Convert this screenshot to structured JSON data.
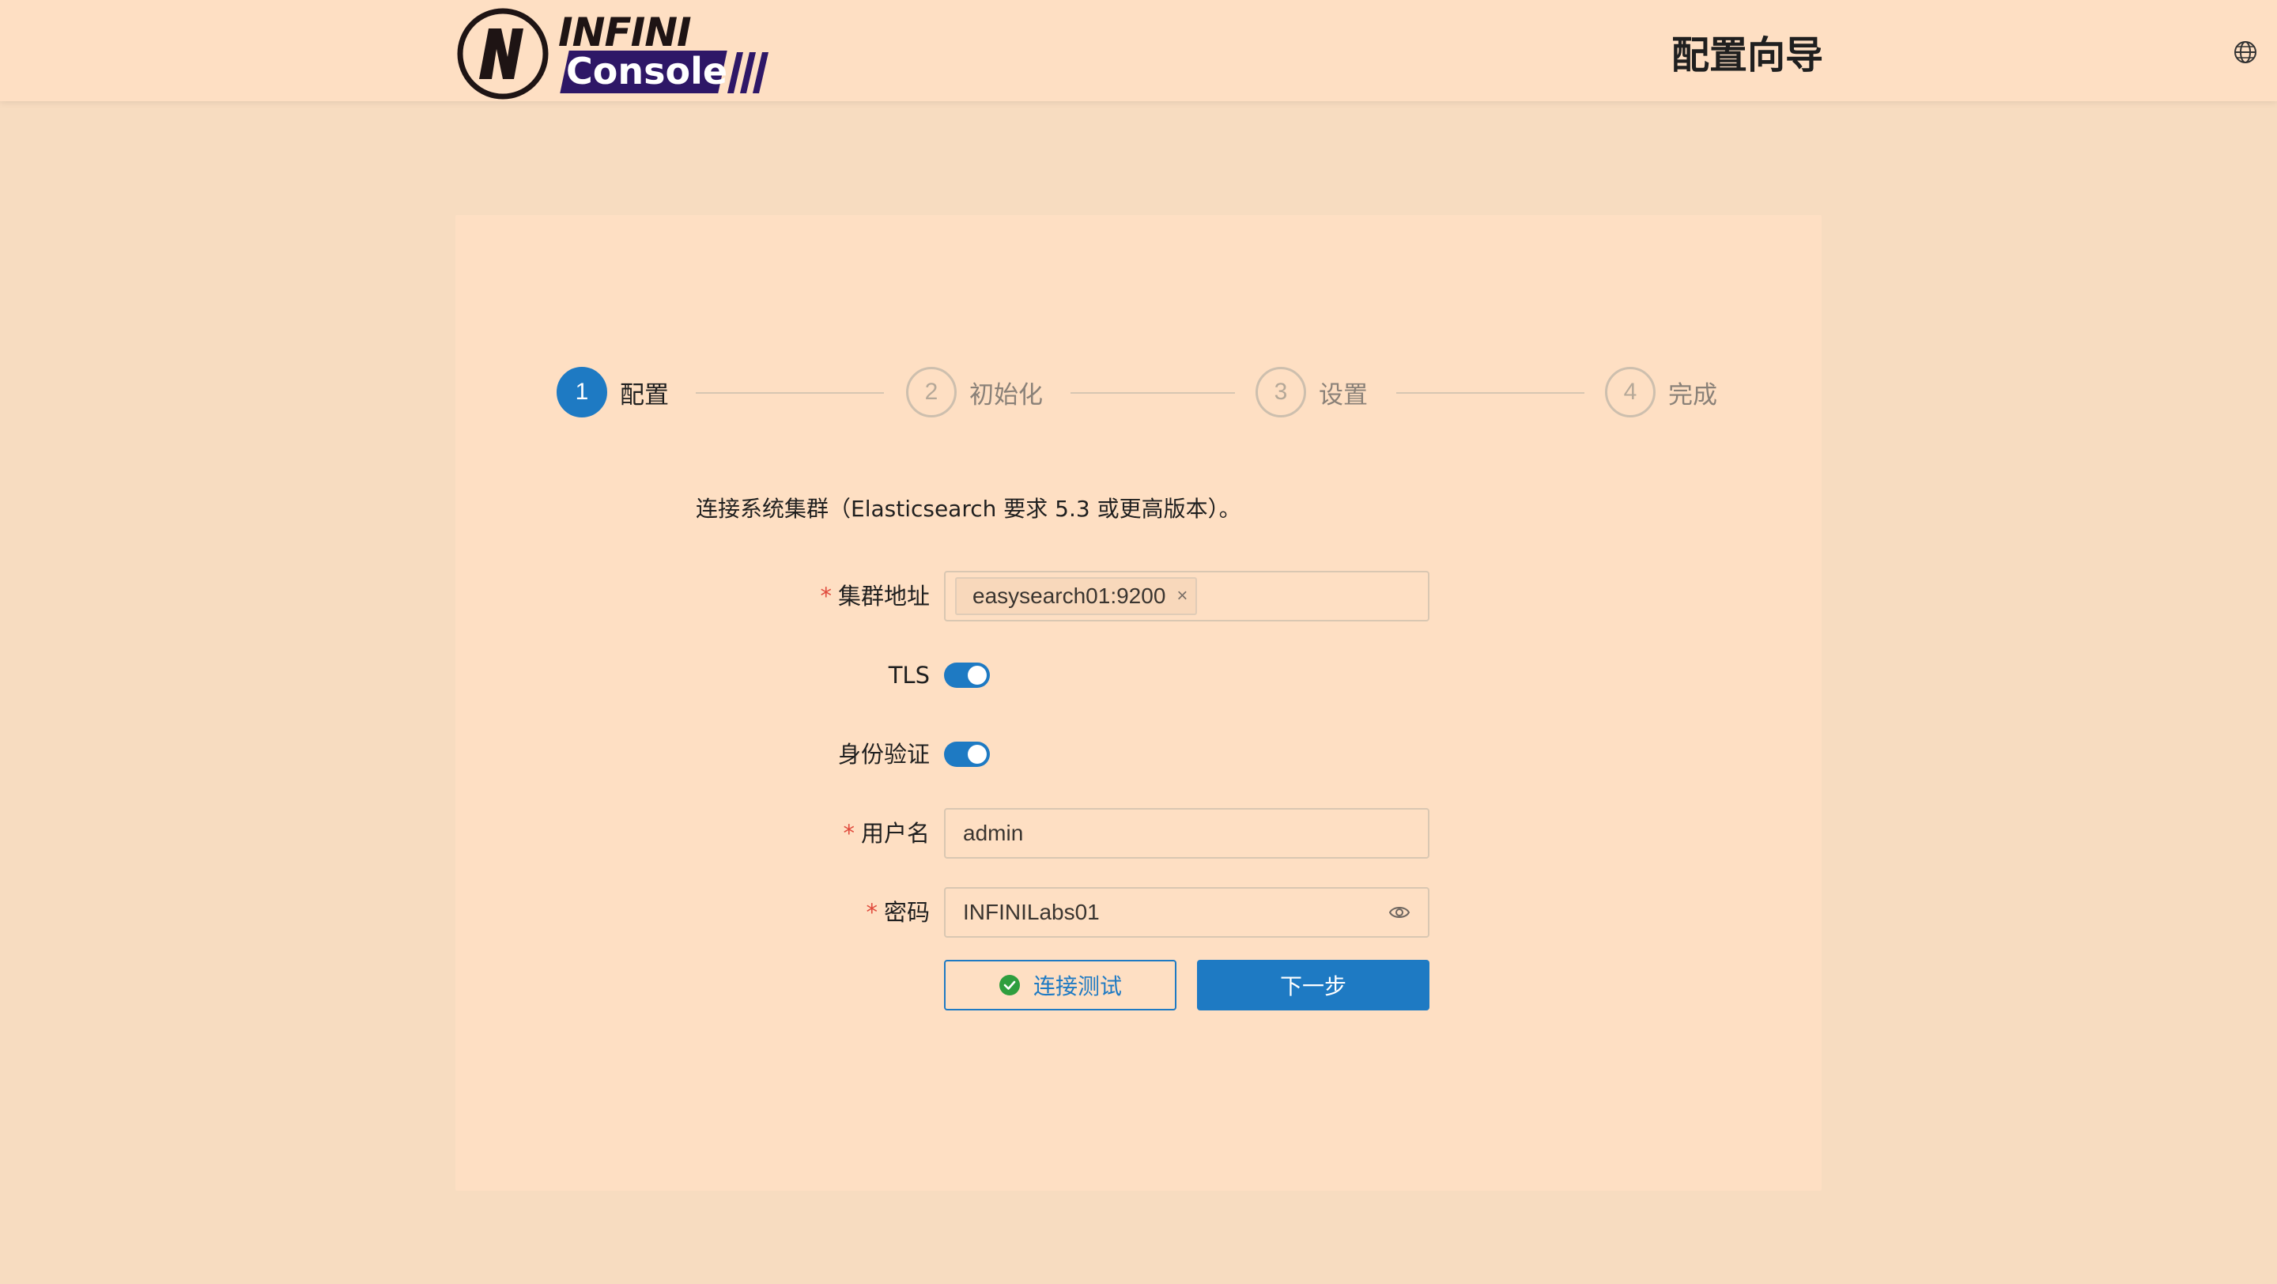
{
  "header": {
    "logo_top": "INFINI",
    "logo_bottom": "Console",
    "title": "配置向导",
    "language_icon": "globe-icon"
  },
  "steps": [
    {
      "number": "1",
      "label": "配置",
      "active": true
    },
    {
      "number": "2",
      "label": "初始化",
      "active": false
    },
    {
      "number": "3",
      "label": "设置",
      "active": false
    },
    {
      "number": "4",
      "label": "完成",
      "active": false
    }
  ],
  "form": {
    "intro": "连接系统集群（Elasticsearch 要求 5.3 或更高版本）。",
    "required_mark": "*",
    "cluster_label": "集群地址",
    "cluster_tag": "easysearch01:9200",
    "tag_close": "×",
    "tls_label": "TLS",
    "tls_on": true,
    "auth_label": "身份验证",
    "auth_on": true,
    "username_label": "用户名",
    "username_value": "admin",
    "password_label": "密码",
    "password_value": "INFINILabs01",
    "test_button": "连接测试",
    "next_button": "下一步"
  },
  "colors": {
    "accent": "#1e7ac3",
    "background": "#f7dcc0",
    "card": "#fedfc3",
    "required": "#e04a3c",
    "success": "#2e9e3e"
  }
}
